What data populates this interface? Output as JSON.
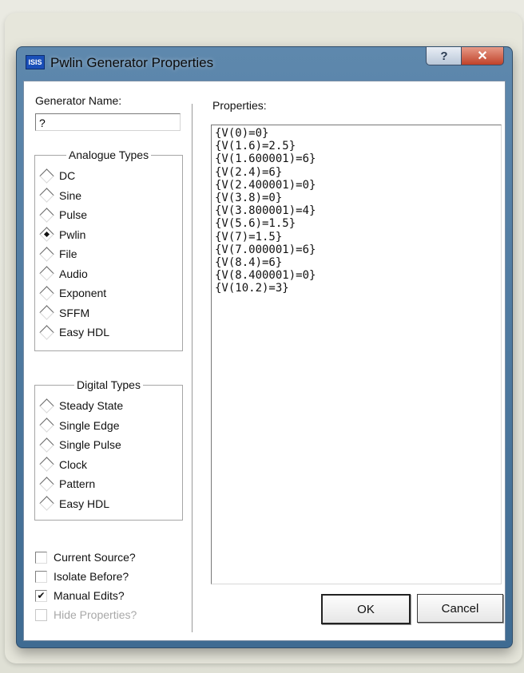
{
  "window": {
    "title": "Pwlin Generator Properties",
    "icon_label": "ISIS",
    "help_label": "?",
    "close_label": "✕"
  },
  "generator": {
    "name_label": "Generator Name:",
    "name_value": "?"
  },
  "analogue": {
    "title": "Analogue Types",
    "selected": "Pwlin",
    "options": [
      "DC",
      "Sine",
      "Pulse",
      "Pwlin",
      "File",
      "Audio",
      "Exponent",
      "SFFM",
      "Easy HDL"
    ]
  },
  "digital": {
    "title": "Digital Types",
    "options": [
      "Steady State",
      "Single Edge",
      "Single Pulse",
      "Clock",
      "Pattern",
      "Easy HDL"
    ]
  },
  "checkboxes": [
    {
      "label": "Current Source?",
      "checked": false,
      "disabled": false
    },
    {
      "label": "Isolate Before?",
      "checked": false,
      "disabled": false
    },
    {
      "label": "Manual Edits?",
      "checked": true,
      "disabled": false
    },
    {
      "label": "Hide Properties?",
      "checked": false,
      "disabled": true
    }
  ],
  "properties": {
    "label": "Properties:",
    "lines": [
      "{V(0)=0}",
      "{V(1.6)=2.5}",
      "{V(1.600001)=6}",
      "{V(2.4)=6}",
      "{V(2.400001)=0}",
      "{V(3.8)=0}",
      "{V(3.800001)=4}",
      "{V(5.6)=1.5}",
      "{V(7)=1.5}",
      "{V(7.000001)=6}",
      "{V(8.4)=6}",
      "{V(8.400001)=0}",
      "{V(10.2)=3}"
    ]
  },
  "buttons": {
    "ok": "OK",
    "cancel": "Cancel"
  }
}
